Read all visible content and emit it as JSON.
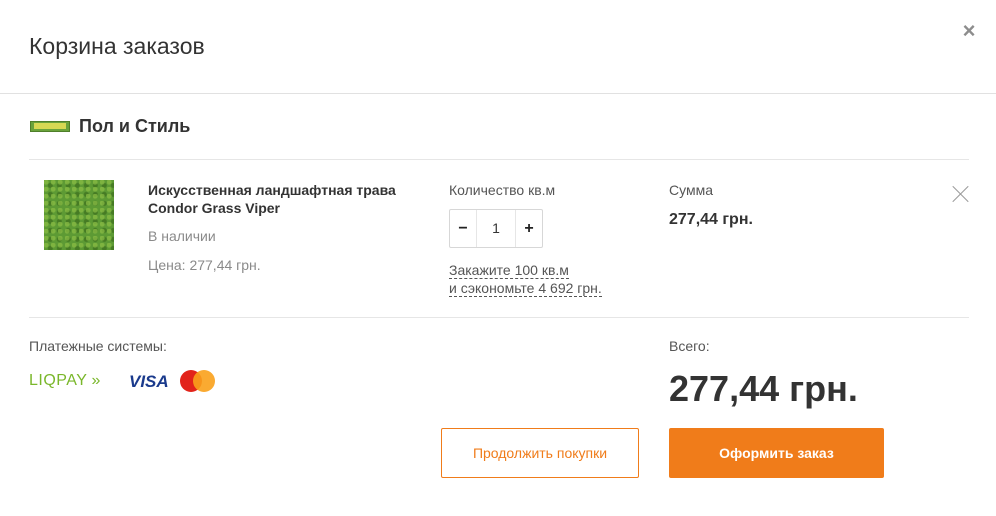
{
  "modal": {
    "title": "Корзина заказов",
    "close_icon": "×"
  },
  "store": {
    "name": "Пол и Стиль"
  },
  "item": {
    "name": "Искусственная ландшафтная трава Condor Grass Viper",
    "availability": "В наличии",
    "price": "Цена: 277,44 грн.",
    "quantity_label": "Количество кв.м",
    "quantity": "1",
    "minus": "−",
    "plus": "+",
    "promo_line1": "Закажите 100 кв.м",
    "promo_line2": "и сэкономьте 4 692 грн.",
    "sum_label": "Сумма",
    "sum_value": "277,44 грн."
  },
  "payment": {
    "label": "Платежные системы:",
    "liqpay": "LIQPAY",
    "liqpay_arrows": "»",
    "visa": "VISA"
  },
  "total": {
    "label": "Всего:",
    "value": "277,44 грн."
  },
  "buttons": {
    "continue": "Продолжить покупки",
    "checkout": "Оформить заказ"
  },
  "colors": {
    "accent": "#f07c1a",
    "liqpay": "#7ab72b",
    "visa": "#1a3a8c"
  }
}
